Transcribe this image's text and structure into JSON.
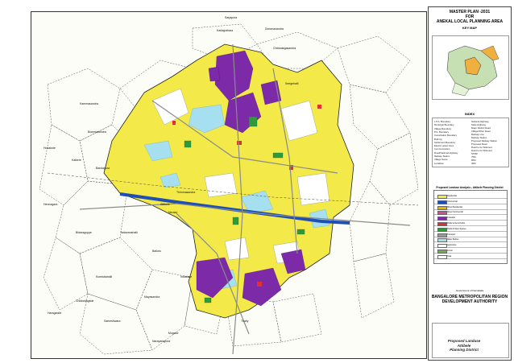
{
  "title_block": {
    "line1": "MASTER PLAN -2031",
    "line2": "FOR",
    "line3": "ANEKAL LOCAL PLANNING AREA",
    "key_map_label": "KEY MAP"
  },
  "index": {
    "title": "INDEX",
    "left_items": [
      "L.P.A. Boundary",
      "Municipal Boundary",
      "Village Boundary",
      "P.G. Boundary",
      "Conurbation Boundary",
      "Built Up",
      "Settlement Boundary",
      "Electric power lines",
      "Communication",
      "Road/National Highway",
      "Railway Station",
      "Village Name",
      "Localities"
    ],
    "right_items": [
      "National Highway",
      "State Highway",
      "Major District Road",
      "Village/Other Road",
      "Railway Line",
      "Railway Station",
      "Proposed Railway Station",
      "Proposed Road",
      "Road to be Widened",
      "Road to be Widened",
      "STRR",
      "75M",
      "60M",
      "45M"
    ]
  },
  "landuse_table": {
    "title": "Proposed Landuse Analysis - Attibele Planning District",
    "rows": [
      {
        "name": "Residential",
        "color": "#f3ea4a"
      },
      {
        "name": "Commercial",
        "color": "#1f4fb3"
      },
      {
        "name": "Mixed Residential",
        "color": "#e4b400"
      },
      {
        "name": "Mixed Commercial",
        "color": "#d0508c"
      },
      {
        "name": "Industrial",
        "color": "#7c2aa8"
      },
      {
        "name": "Public & Semi Public",
        "color": "#e03030"
      },
      {
        "name": "Parks & Open Spaces",
        "color": "#2e9a3c"
      },
      {
        "name": "Transport",
        "color": "#9a9a9a"
      },
      {
        "name": "Water Bodies",
        "color": "#a6dff0"
      },
      {
        "name": "Agriculture",
        "color": "#ffffff"
      },
      {
        "name": "Forest",
        "color": "#6ab04c"
      },
      {
        "name": "Total",
        "color": "#ffffff"
      }
    ]
  },
  "authority": {
    "gov": "Government of Karnataka",
    "name_line1": "BANGALORE METROPOLITAN REGION",
    "name_line2": "DEVELOPMENT AUTHORITY"
  },
  "drawing_title": {
    "line1": "Proposed Landuse",
    "line2": "Attibele",
    "line3": "Planning District"
  },
  "map_labels": {
    "top": [
      "Sarjapura",
      "Kadagrahara",
      "Dommasandra",
      "Chikkatagasandra",
      "Seegehalli"
    ],
    "west": [
      "Kammasandra",
      "Bommasandra",
      "Hosakote",
      "Kalkere",
      "Bandapura",
      "Hennagara",
      "Bidaraguppe"
    ],
    "center": [
      "Attibele",
      "Neralur",
      "Thimmasandra",
      "Yadavanahalli",
      "Balluru",
      "Indlabele",
      "Mayasandra"
    ],
    "south": [
      "Kumbalahalli",
      "Chikkahagade",
      "Haragadde",
      "Sameshwara",
      "Mugalur",
      "Narayanapura",
      "Thally"
    ]
  },
  "colors": {
    "residential": "#f3ea4a",
    "industrial": "#7c2aa8",
    "park": "#2e9a3c",
    "water": "#a6dff0",
    "commercial": "#1f4fb3",
    "public": "#e03030",
    "road": "#8a8a8a"
  }
}
